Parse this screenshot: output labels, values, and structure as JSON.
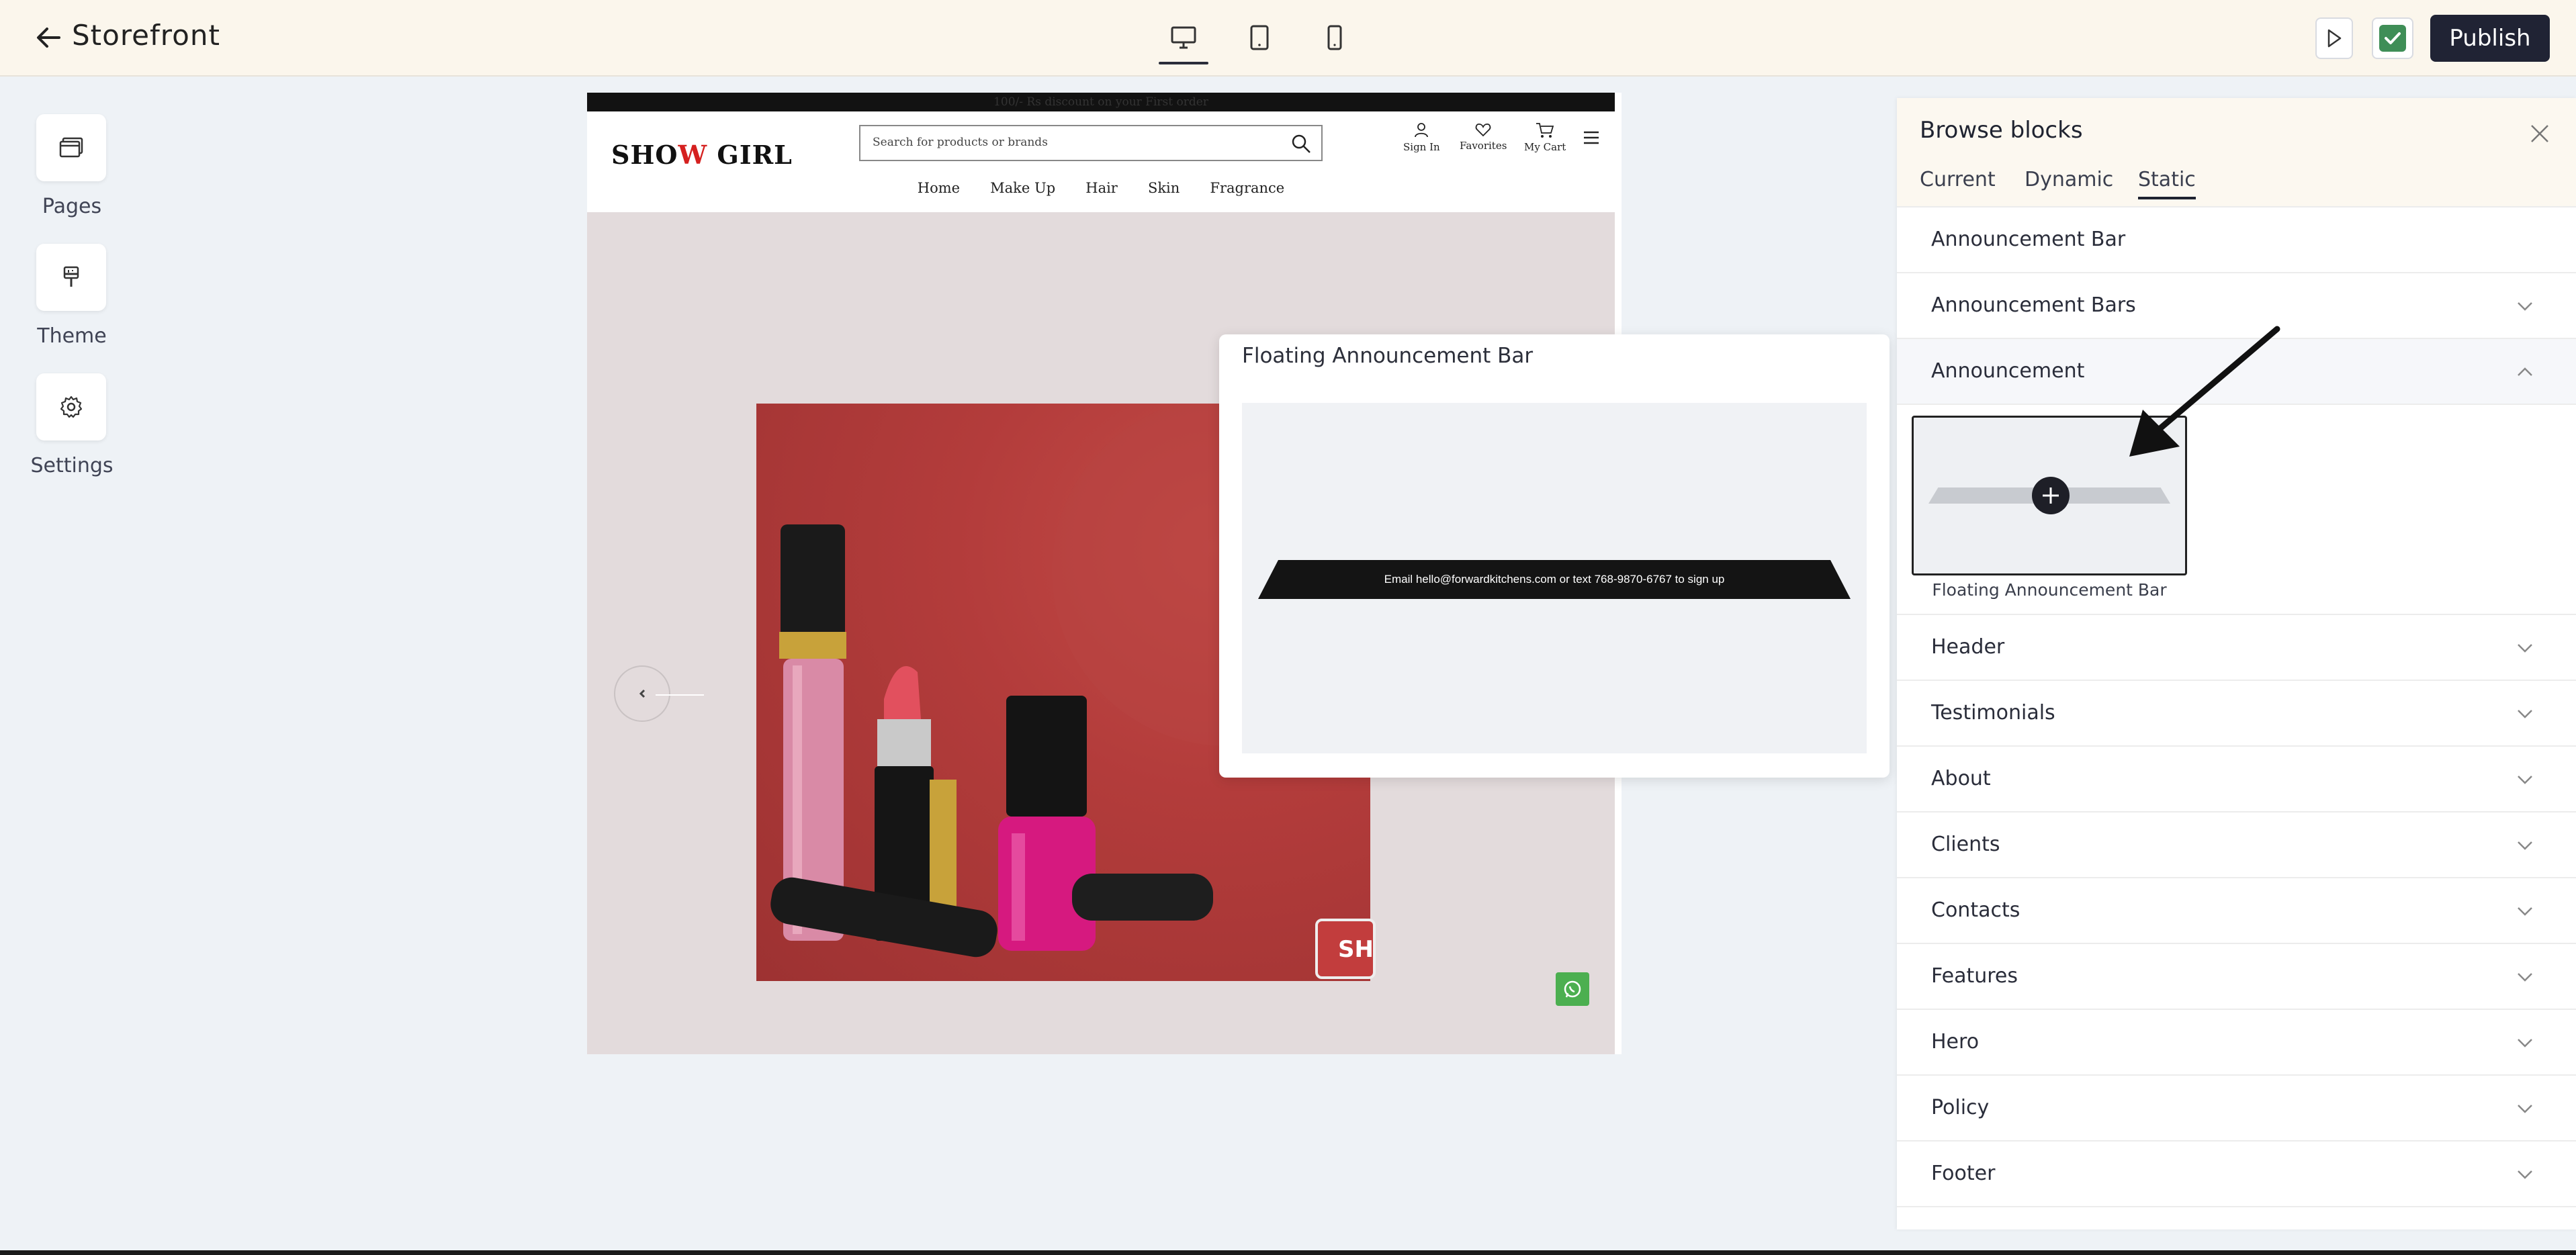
{
  "topbar": {
    "title": "Storefront",
    "publish_label": "Publish"
  },
  "rail": {
    "items": [
      {
        "label": "Pages"
      },
      {
        "label": "Theme"
      },
      {
        "label": "Settings"
      }
    ]
  },
  "storefront": {
    "promo_text": "100/- Rs discount on your First order",
    "logo_left": "SHO",
    "logo_mid": "W",
    "logo_right": " GIRL",
    "search_placeholder": "Search for products or brands",
    "util": {
      "signin": "Sign In",
      "favorites": "Favorites",
      "cart": "My Cart"
    },
    "nav": [
      "Home",
      "Make Up",
      "Hair",
      "Skin",
      "Fragrance"
    ],
    "shop_button": "SH"
  },
  "preview": {
    "title": "Floating Announcement Bar",
    "bar_text": "Email hello@forwardkitchens.com or text 768-9870-6767 to sign up"
  },
  "panel": {
    "title": "Browse blocks",
    "tabs": [
      "Current",
      "Dynamic",
      "Static"
    ],
    "active_tab": "Static",
    "rows": [
      "Announcement Bar",
      "Announcement Bars",
      "Announcement",
      "Header",
      "Testimonials",
      "About",
      "Clients",
      "Contacts",
      "Features",
      "Hero",
      "Policy",
      "Footer"
    ],
    "expanded": "Announcement",
    "thumb_label": "Floating Announcement Bar"
  },
  "colors": {
    "accent": "#202334",
    "check": "#3f8e57",
    "hero": "#b33c3b",
    "brand_red": "#d5201f"
  }
}
